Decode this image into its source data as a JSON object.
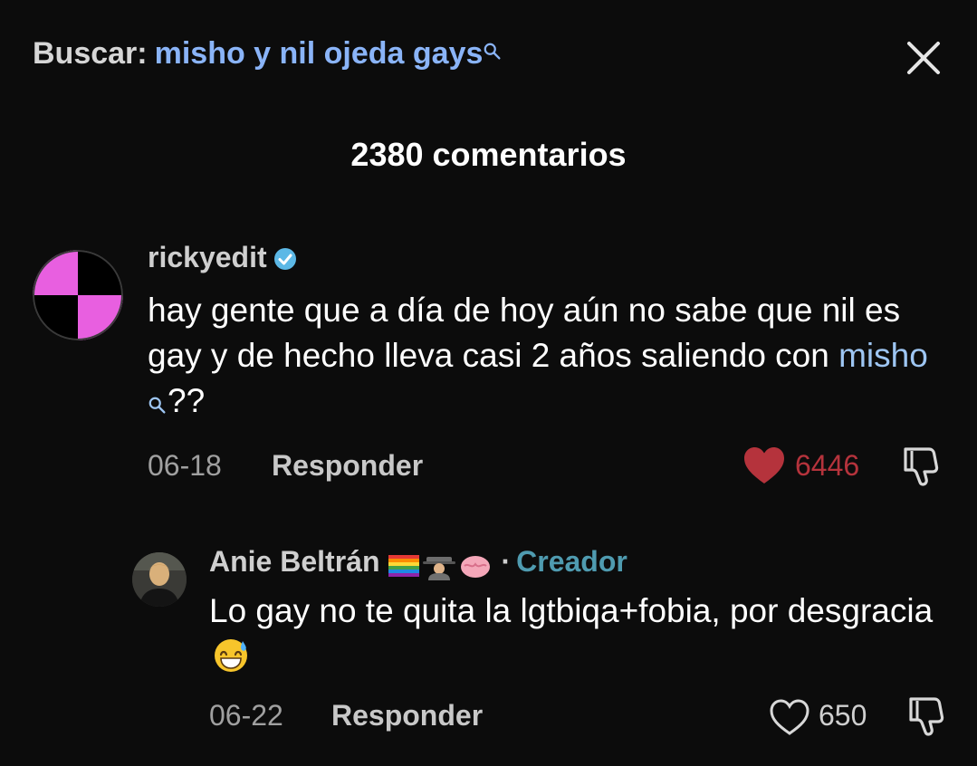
{
  "header": {
    "search_prefix": "Buscar:",
    "search_query": "misho y nil ojeda gays",
    "search_icon": "search-icon",
    "close_icon": "close-icon"
  },
  "comments_count": "2380 comentarios",
  "comment": {
    "username": "rickyedit",
    "verified_icon": "verified-badge-icon",
    "text_before": "hay gente que a día de hoy aún no sabe que nil es gay y de hecho lleva casi 2 años saliendo con ",
    "mention": "misho",
    "text_after": "??",
    "date": "06-18",
    "reply_label": "Responder",
    "likes": "6446",
    "liked": true,
    "colors": {
      "like": "#b5333c",
      "avatar_pink": "#e85fe0"
    }
  },
  "reply": {
    "username": "Anie Beltrán",
    "flair_icons": [
      "rainbow-flag-icon",
      "detective-icon",
      "brain-icon"
    ],
    "separator": "·",
    "role": "Creador",
    "text": "Lo gay no te quita la lgtbiqa+fobia, por desgracia",
    "emoji_icon": "grinning-sweat-emoji-icon",
    "date": "06-22",
    "reply_label": "Responder",
    "likes": "650",
    "liked": false,
    "colors": {
      "role": "#4f9bb0"
    }
  }
}
